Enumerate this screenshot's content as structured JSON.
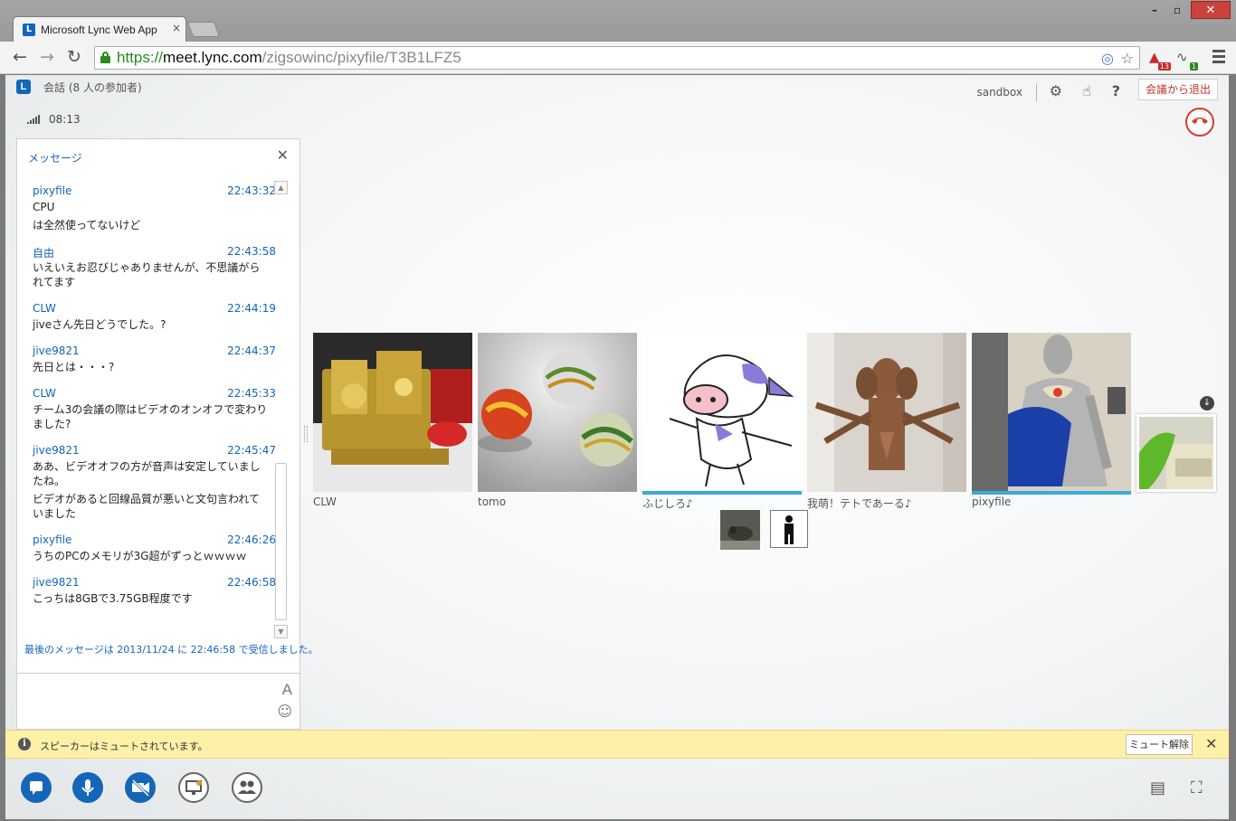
{
  "browser": {
    "tab_title": "Microsoft Lync Web App",
    "tab_close": "×",
    "url_protocol": "https://",
    "url_host": "meet.lync.com",
    "url_path": "/zigsowinc/pixyfile/T3B1LFZ5",
    "extension_badges": [
      "13",
      "1"
    ]
  },
  "app": {
    "logo_letter": "L",
    "conversation_title": "会話 (8 人の参加者)",
    "call_timer": "08:13",
    "user_name": "sandbox",
    "leave_button": "会議から退出",
    "icons": [
      "gear-icon",
      "hand-icon",
      "help-icon",
      "hangup-icon"
    ]
  },
  "messages_panel": {
    "title": "メッセージ",
    "close_label": "✕",
    "messages": [
      {
        "sender": "pixyfile",
        "time": "22:43:32",
        "lines": [
          "CPU",
          "は全然使ってないけど"
        ]
      },
      {
        "sender": "自由",
        "time": "22:43:58",
        "lines": [
          "いえいえお忍びじゃありませんが、不思議がられてます"
        ]
      },
      {
        "sender": "CLW",
        "time": "22:44:19",
        "lines": [
          "jiveさん先日どうでした。?"
        ]
      },
      {
        "sender": "jive9821",
        "time": "22:44:37",
        "lines": [
          "先日とは・・・?"
        ]
      },
      {
        "sender": "CLW",
        "time": "22:45:33",
        "lines": [
          "チーム3の会議の際はビデオのオンオフで変わりました?"
        ]
      },
      {
        "sender": "jive9821",
        "time": "22:45:47",
        "lines": [
          "ああ、ビデオオフの方が音声は安定していましたね。",
          "ビデオがあると回線品質が悪いと文句言われていました"
        ]
      },
      {
        "sender": "pixyfile",
        "time": "22:46:26",
        "lines": [
          "うちのPCのメモリが3G超がずっとｗｗｗｗ"
        ]
      },
      {
        "sender": "jive9821",
        "time": "22:46:58",
        "lines": [
          "こっちは8GBで3.75GB程度です"
        ]
      }
    ],
    "last_received": "最後のメッセージは 2013/11/24 に 22:46:58 で受信しました。",
    "font_button": "A",
    "emoji_button": "☺"
  },
  "gallery": {
    "participants": [
      {
        "name": "CLW",
        "speaking": false
      },
      {
        "name": "tomo",
        "speaking": false
      },
      {
        "name": "ふじしろ♪",
        "speaking": true
      },
      {
        "name": "我萌！テトであーる♪",
        "speaking": false
      },
      {
        "name": "pixyfile",
        "speaking": true
      }
    ]
  },
  "notification": {
    "info_glyph": "i",
    "text": "スピーカーはミュートされています。",
    "unmute_button": "ミュート解除",
    "close_label": "✕"
  },
  "bottom_bar": {
    "buttons": [
      "im-icon",
      "microphone-icon",
      "video-off-icon",
      "present-icon",
      "participants-icon"
    ],
    "right_icons": [
      "meeting-layout-icon",
      "fullscreen-icon"
    ]
  },
  "colors": {
    "accent": "#1466b8",
    "speaking_bar": "#3ba9d9",
    "leave": "#c3362b",
    "notify_bg": "#fdf1a8"
  }
}
